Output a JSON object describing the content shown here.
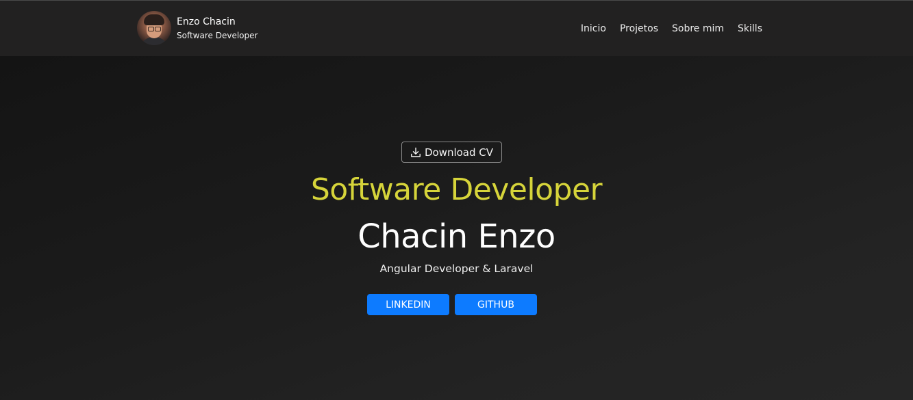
{
  "header": {
    "name": "Enzo Chacin",
    "role": "Software Developer",
    "nav": [
      {
        "label": "Inicio"
      },
      {
        "label": "Projetos"
      },
      {
        "label": "Sobre mim"
      },
      {
        "label": "Skills"
      }
    ]
  },
  "hero": {
    "download_label": "Download CV",
    "download_icon": "download-icon",
    "headline": "Software Developer",
    "name": "Chacin Enzo",
    "subtitle": "Angular Developer & Laravel",
    "buttons": [
      {
        "label": "LINKEDIN"
      },
      {
        "label": "GITHUB"
      }
    ]
  },
  "colors": {
    "accent_yellow": "#d6d43a",
    "button_blue": "#0d7bff",
    "background": "#1c1c1c",
    "header_background": "#222121"
  }
}
